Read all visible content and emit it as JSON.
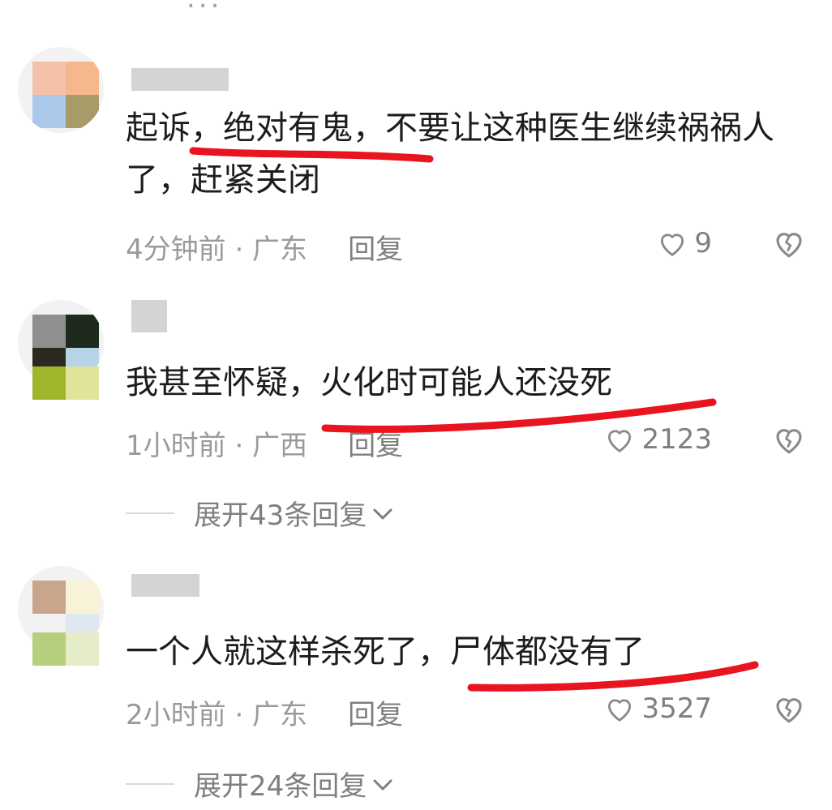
{
  "top_fragment": "...",
  "comments": [
    {
      "text": "起诉，绝对有鬼，不要让这种医生继续祸祸人了，赶紧关闭",
      "time_location": "4分钟前 · 广东",
      "reply_label": "回复",
      "likes": "9",
      "avatar_colors": [
        "#f3c2a8",
        "#f7b78d",
        "#a9c8ea",
        "#a99a6a"
      ]
    },
    {
      "text": "我甚至怀疑，火化时可能人还没死",
      "time_location": "1小时前 · 广西",
      "reply_label": "回复",
      "likes": "2123",
      "expand_label": "展开43条回复",
      "avatar_colors": [
        "#8f8f8f",
        "#1e2a1e",
        "#2c2a20",
        "#b6d3e8",
        "#9fb52a",
        "#dfe49a"
      ]
    },
    {
      "text": "一个人就这样杀死了，尸体都没有了",
      "time_location": "2小时前 · 广东",
      "reply_label": "回复",
      "likes": "3527",
      "expand_label": "展开24条回复",
      "avatar_colors": [
        "#c9a58c",
        "#f7f2d8",
        "#f2f2f2",
        "#dfe7ef",
        "#b5cf7d",
        "#e5ecc8"
      ]
    }
  ],
  "annotation_color": "#e8141f"
}
